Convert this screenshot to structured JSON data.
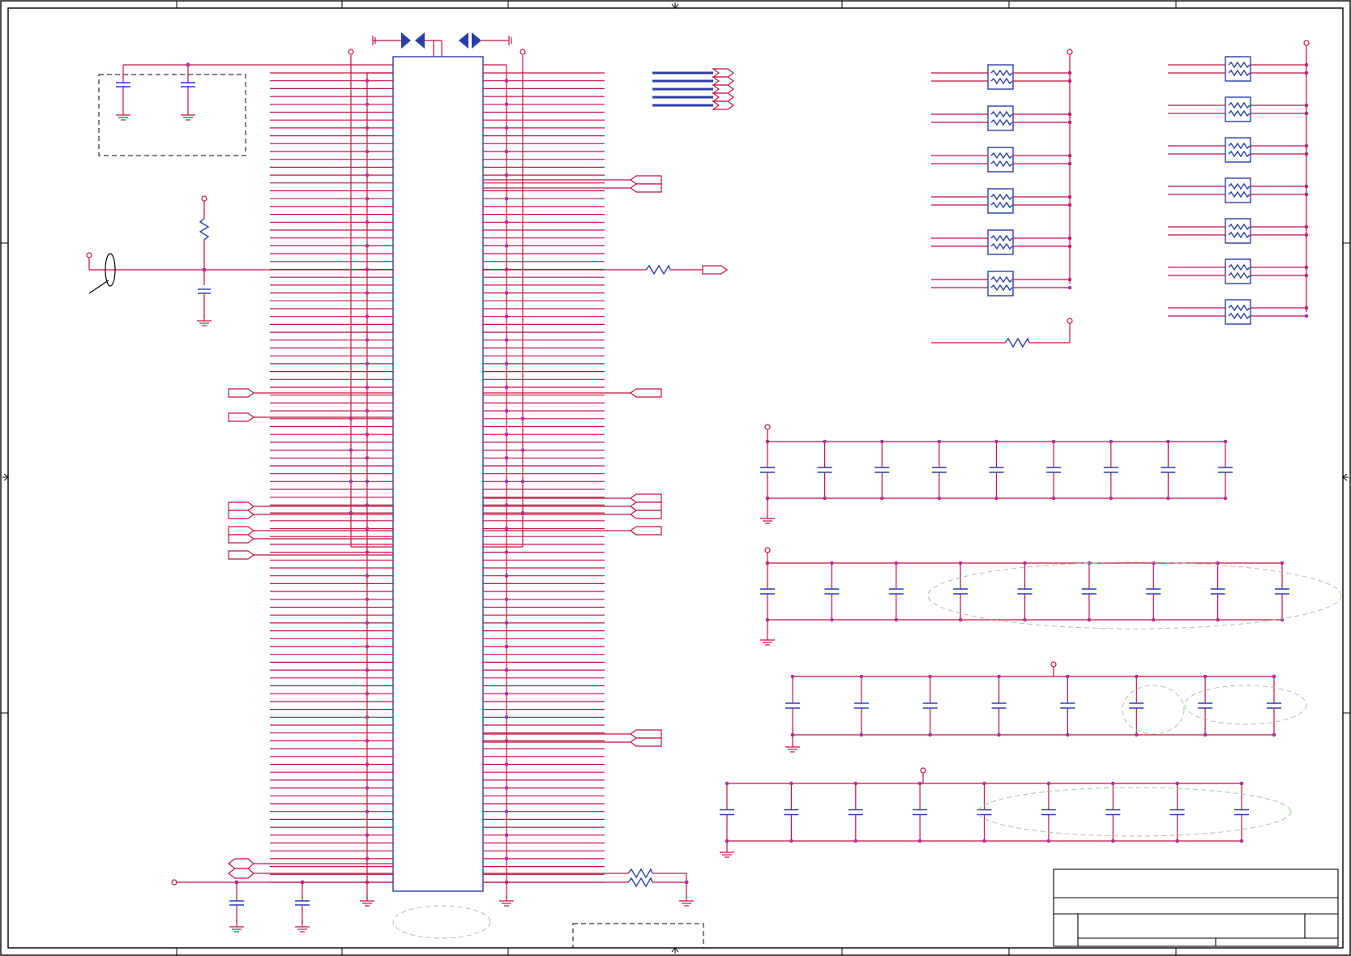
{
  "diagram": {
    "title": "",
    "components": {
      "main_ic": {
        "pins_per_side": 52
      },
      "decoupling_rows": [
        {
          "count": 9
        },
        {
          "count": 9
        },
        {
          "count": 8
        },
        {
          "count": 9
        }
      ],
      "resistor_arrays_left": {
        "count": 6
      },
      "resistor_arrays_right": {
        "count": 7
      }
    },
    "colors": {
      "wire": "#c4123f",
      "component": "#2a3fa8",
      "junction": "#b52fa0",
      "frame": "#000000"
    }
  }
}
